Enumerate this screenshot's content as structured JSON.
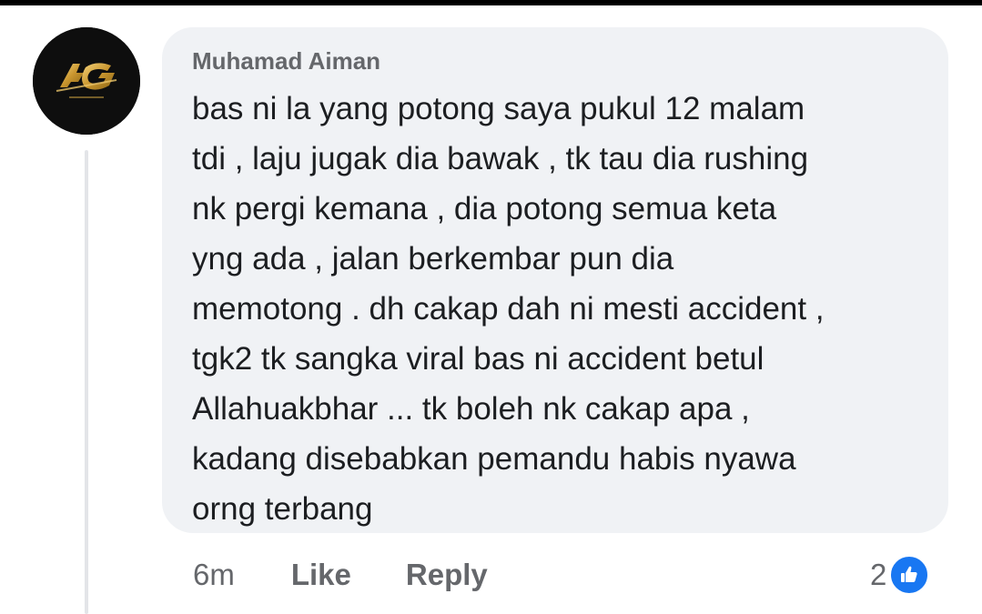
{
  "comment": {
    "author": "Muhamad Aiman",
    "avatar_icon": "ag-logo-avatar",
    "text_lines": [
      "bas ni la yang potong saya pukul 12 malam",
      "tdi , laju jugak dia bawak , tk tau dia rushing",
      "nk pergi kemana , dia potong semua keta",
      "yng ada , jalan berkembar pun dia",
      "memotong . dh cakap dah ni mesti accident ,",
      "tgk2 tk sangka viral bas ni accident betul",
      "Allahuakbhar ... tk boleh nk cakap apa ,",
      "kadang disebabkan pemandu habis nyawa",
      "orng terbang"
    ],
    "avatar_logo_text": "AG"
  },
  "actions": {
    "time": "6m",
    "like_label": "Like",
    "reply_label": "Reply"
  },
  "reactions": {
    "count": "2",
    "icon": "thumbs-up-icon"
  },
  "colors": {
    "bubble": "#f0f2f5",
    "text": "#1c1e21",
    "muted": "#65676b",
    "like_blue": "#1877f2"
  }
}
